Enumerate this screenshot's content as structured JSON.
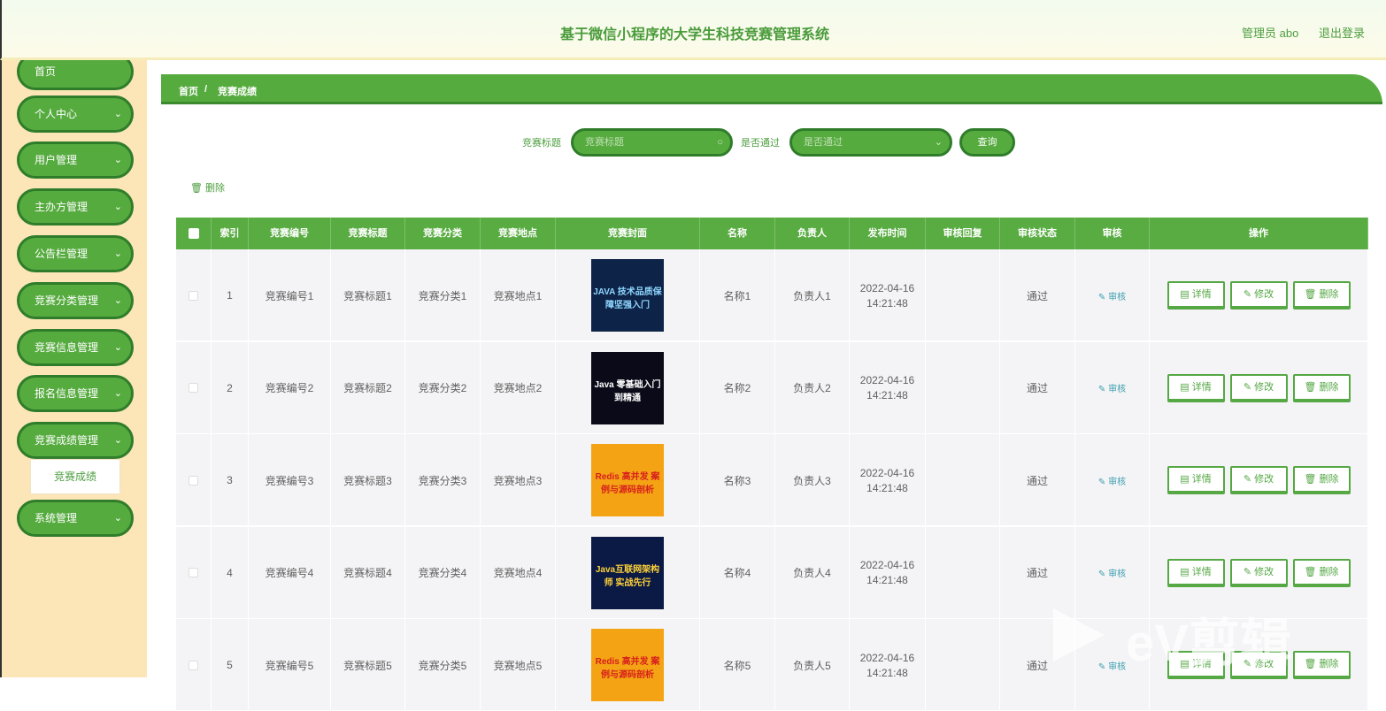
{
  "header": {
    "title": "基于微信小程序的大学生科技竞赛管理系统",
    "user": "管理员 abo",
    "logout": "退出登录"
  },
  "sidebar": {
    "items": [
      {
        "label": "首页",
        "chevron": false
      },
      {
        "label": "个人中心",
        "chevron": true
      },
      {
        "label": "用户管理",
        "chevron": true
      },
      {
        "label": "主办方管理",
        "chevron": true
      },
      {
        "label": "公告栏管理",
        "chevron": true
      },
      {
        "label": "竞赛分类管理",
        "chevron": true
      },
      {
        "label": "竞赛信息管理",
        "chevron": true
      },
      {
        "label": "报名信息管理",
        "chevron": true
      },
      {
        "label": "竞赛成绩管理",
        "chevron": true
      },
      {
        "label": "系统管理",
        "chevron": true
      }
    ],
    "sub_item": "竞赛成绩",
    "chevron_glyph": "⌄"
  },
  "breadcrumb": {
    "home": "首页",
    "sep": "/",
    "current": "竞赛成绩"
  },
  "search": {
    "title_label": "竞赛标题",
    "title_placeholder": "竞赛标题",
    "pass_label": "是否通过",
    "pass_placeholder": "是否通过",
    "query": "查询",
    "search_icon": "search-icon",
    "chevron_icon": "chevron-down-icon"
  },
  "toolbar": {
    "delete": "删除",
    "delete_icon": "trash-icon"
  },
  "table": {
    "headers": [
      "索引",
      "竞赛编号",
      "竞赛标题",
      "竞赛分类",
      "竞赛地点",
      "竞赛封面",
      "名称",
      "负责人",
      "发布时间",
      "审核回复",
      "审核状态",
      "审核",
      "操作"
    ],
    "rows": [
      {
        "index": "1",
        "code": "竞赛编号1",
        "title": "竞赛标题1",
        "category": "竞赛分类1",
        "place": "竞赛地点1",
        "cover": "c1",
        "name": "名称1",
        "owner": "负责人1",
        "date": "2022-04-16",
        "time": "14:21:48",
        "reply": "",
        "status": "通过"
      },
      {
        "index": "2",
        "code": "竞赛编号2",
        "title": "竞赛标题2",
        "category": "竞赛分类2",
        "place": "竞赛地点2",
        "cover": "c2",
        "name": "名称2",
        "owner": "负责人2",
        "date": "2022-04-16",
        "time": "14:21:48",
        "reply": "",
        "status": "通过"
      },
      {
        "index": "3",
        "code": "竞赛编号3",
        "title": "竞赛标题3",
        "category": "竞赛分类3",
        "place": "竞赛地点3",
        "cover": "c3",
        "name": "名称3",
        "owner": "负责人3",
        "date": "2022-04-16",
        "time": "14:21:48",
        "reply": "",
        "status": "通过"
      },
      {
        "index": "4",
        "code": "竞赛编号4",
        "title": "竞赛标题4",
        "category": "竞赛分类4",
        "place": "竞赛地点4",
        "cover": "c4",
        "name": "名称4",
        "owner": "负责人4",
        "date": "2022-04-16",
        "time": "14:21:48",
        "reply": "",
        "status": "通过"
      },
      {
        "index": "5",
        "code": "竞赛编号5",
        "title": "竞赛标题5",
        "category": "竞赛分类5",
        "place": "竞赛地点5",
        "cover": "c3",
        "name": "名称5",
        "owner": "负责人5",
        "date": "2022-04-16",
        "time": "14:21:48",
        "reply": "",
        "status": "通过"
      }
    ],
    "audit_label": "审核",
    "actions": {
      "detail": "详情",
      "edit": "修改",
      "delete": "删除"
    },
    "covers": {
      "c1": {
        "bg": "#0d2347",
        "text": "JAVA 技术品质保障坚强入门",
        "color": "#8fd6ff"
      },
      "c2": {
        "bg": "#0a0a18",
        "text": "Java 零基础入门到精通",
        "color": "#ffffff"
      },
      "c3": {
        "bg": "#f3a313",
        "text": "Redis 高并发 案例与源码剖析",
        "color": "#d81e1e"
      },
      "c4": {
        "bg": "#0b1a44",
        "text": "Java互联网架构师 实战先行",
        "color": "#ffd23a"
      }
    }
  },
  "watermark": "eV剪辑"
}
